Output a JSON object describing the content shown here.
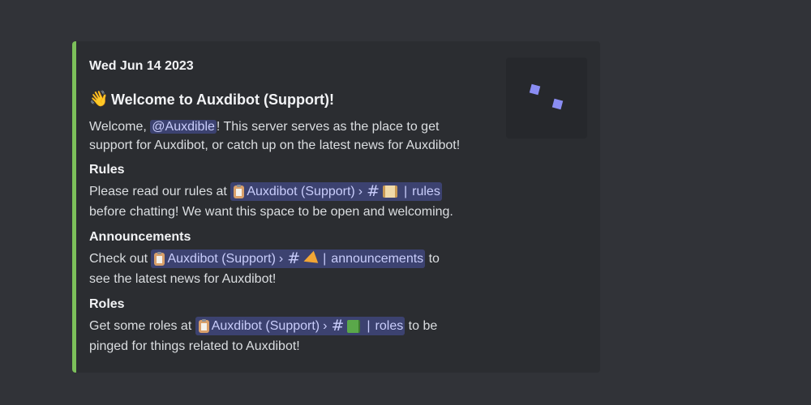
{
  "embed": {
    "accent_color": "#7cc05a",
    "timestamp": "Wed Jun 14 2023",
    "title_emoji": "waving-hand-icon",
    "title": "Welcome to Auxdibot (Support)!",
    "intro": {
      "before": "Welcome, ",
      "mention": "@Auxdible",
      "after": "! This server serves as the place to get",
      "line2": "support for Auxdibot, or catch up on the latest news for Auxdibot!"
    },
    "fields": {
      "rules": {
        "name": "Rules",
        "before": "Please read our rules at ",
        "server": "Auxdibot (Support)",
        "channel": "rules",
        "line2": "before chatting! We want this space to be open and welcoming."
      },
      "announcements": {
        "name": "Announcements",
        "before": "Check out ",
        "server": "Auxdibot (Support)",
        "channel": "announcements",
        "after": " to",
        "line2": "see the latest news for Auxdibot!"
      },
      "roles": {
        "name": "Roles",
        "before": "Get some roles at ",
        "server": "Auxdibot (Support)",
        "channel": "roles",
        "after": " to be",
        "line2": "pinged for things related to Auxdibot!"
      }
    },
    "symbols": {
      "chevron": "›",
      "hash": "#",
      "pipe": "|"
    }
  }
}
